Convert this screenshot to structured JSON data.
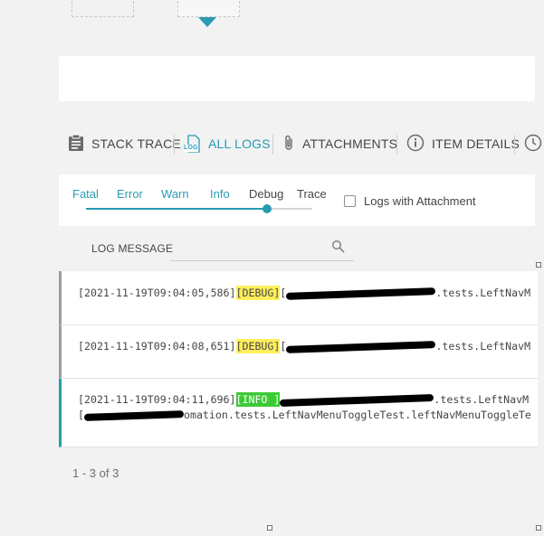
{
  "tabs": [
    {
      "label": "STACK TRACE",
      "icon": "clipboard-icon"
    },
    {
      "label": "ALL LOGS",
      "icon": "log-file-icon",
      "icon_text": "LOG",
      "active": true
    },
    {
      "label": "ATTACHMENTS",
      "icon": "paperclip-icon"
    },
    {
      "label": "ITEM DETAILS",
      "icon": "info-circle-icon"
    }
  ],
  "levels": {
    "items": [
      "Fatal",
      "Error",
      "Warn",
      "Info",
      "Debug",
      "Trace"
    ],
    "selected": "Debug",
    "slider_position": 0.8
  },
  "logs_with_attachment": {
    "label": "Logs with Attachment",
    "checked": false
  },
  "filter": {
    "label": "LOG MESSAGE",
    "value": ""
  },
  "logs": [
    {
      "timestamp": "[2021-11-19T09:04:05,586]",
      "level": "[DEBUG]",
      "open_bracket": "[",
      "message_tail": ".tests.LeftNavM"
    },
    {
      "timestamp": "[2021-11-19T09:04:08,651]",
      "level": "[DEBUG]",
      "open_bracket": "[",
      "message_tail": ".tests.LeftNavM"
    },
    {
      "timestamp": "[2021-11-19T09:04:11,696]",
      "level": "[INFO ]",
      "open_bracket": "[",
      "message_tail": ".tests.LeftNavM",
      "line2_tail": "omation.tests.LeftNavMenuToggleTest.leftNavMenuToggleTe"
    }
  ],
  "pagination": {
    "text": "1 - 3 of 3"
  },
  "colors": {
    "accent": "#2a9bb3",
    "debug_badge": "#ffef5c",
    "info_badge": "#3cca36",
    "text": "#464547"
  }
}
